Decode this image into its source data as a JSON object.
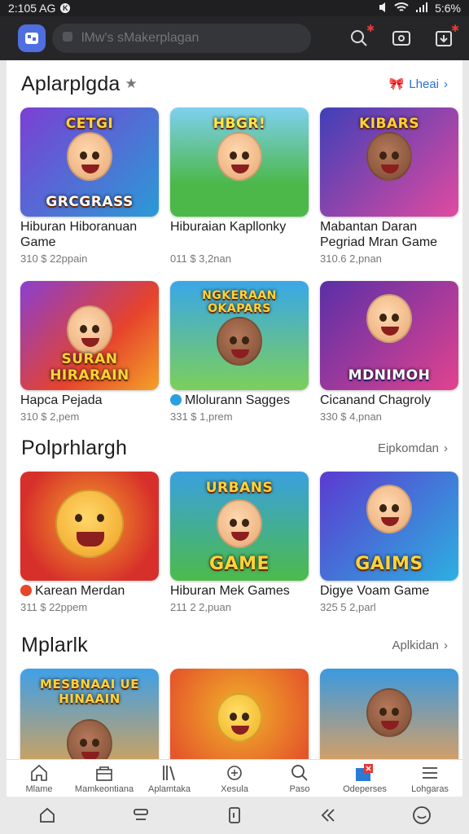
{
  "status_bar": {
    "time": "2:105 AG",
    "battery": "5:6%"
  },
  "search": {
    "placeholder": "lMw's sMakerplagan"
  },
  "sections": [
    {
      "title": "Aplarplgda",
      "more": "Lheai",
      "items": [
        {
          "title": "Hiburan Hiboranuan Game",
          "meta": "310 $ 22ppain",
          "banner": "GRCGRASS",
          "banner_top": "CETGI",
          "bg": "#7b3fd4",
          "bg2": "#2b9ad6"
        },
        {
          "title": "Hiburaian Kapllonky",
          "meta": "011 $ 3,2nan",
          "banner": "",
          "banner_top": "HBGR!",
          "bg": "#4cb84a",
          "bg2": "#7fd0f0"
        },
        {
          "title": "Mabantan Daran Pegriad Mran Game",
          "meta": "310.6 2,pnan",
          "banner": "",
          "banner_top": "KIBARS",
          "bg": "#3f3fb8",
          "bg2": "#e04aa0"
        }
      ]
    },
    {
      "items": [
        {
          "title": "Hapca Pejada",
          "meta": "310 $ 2,pem",
          "banner": "SURAN HIRARAIN",
          "banner_top": "",
          "bg": "#e6432c",
          "bg2": "#8a3fd0"
        },
        {
          "title": "Mlolurann Sagges",
          "meta": "331 $ 1,prem",
          "banner": "",
          "banner_top": "NGKERAAN OKAPARS",
          "bg": "#39a7e8",
          "bg2": "#7ccf5a"
        },
        {
          "title": "Cicanand Chagroly",
          "meta": "330 $ 4,pnan",
          "banner": "MDNIMOH",
          "banner_top": "",
          "bg": "#5a2fa8",
          "bg2": "#e2438f"
        }
      ]
    },
    {
      "title": "Polprhlargh",
      "more": "Eipkomdan",
      "items": [
        {
          "title": "Karean Merdan",
          "meta": "311 $ 22ppem",
          "banner": "",
          "banner_top": "",
          "bg": "#d72f2a",
          "bg2": "#f4a229"
        },
        {
          "title": "Hiburan Mek Games",
          "meta": "211 2 2,puan",
          "banner": "GAME",
          "banner_top": "URBANS",
          "bg": "#3aa0e0",
          "bg2": "#4cbb4a"
        },
        {
          "title": "Digye Voam Game",
          "meta": "325 5 2,parl",
          "banner": "GAIMS",
          "banner_top": "",
          "bg": "#5b3ad0",
          "bg2": "#2db0e0"
        }
      ]
    },
    {
      "title": "Mplarlk",
      "more": "Aplkidan",
      "items": [
        {
          "banner_top": "MESBNAAI UE HINAAIN",
          "bg": "#3fa0e8",
          "bg2": "#e2a24a"
        },
        {
          "banner_top": "",
          "bg": "#f0b32a",
          "bg2": "#e5572a"
        },
        {
          "banner_top": "",
          "bg": "#f0a050",
          "bg2": "#3a9ae0"
        }
      ]
    }
  ],
  "bottom_nav": [
    {
      "label": "Mlame",
      "icon": "home-icon"
    },
    {
      "label": "Mamkeontiana",
      "icon": "store-icon"
    },
    {
      "label": "Aplamtaka",
      "icon": "books-icon"
    },
    {
      "label": "Xesula",
      "icon": "controller-icon"
    },
    {
      "label": "Paso",
      "icon": "search-icon"
    },
    {
      "label": "Odeperses",
      "icon": "gift-icon"
    },
    {
      "label": "Lohgaras",
      "icon": "menu-icon"
    }
  ],
  "colors": {
    "accent": "#2a6fd6",
    "badge": "#e53935"
  }
}
